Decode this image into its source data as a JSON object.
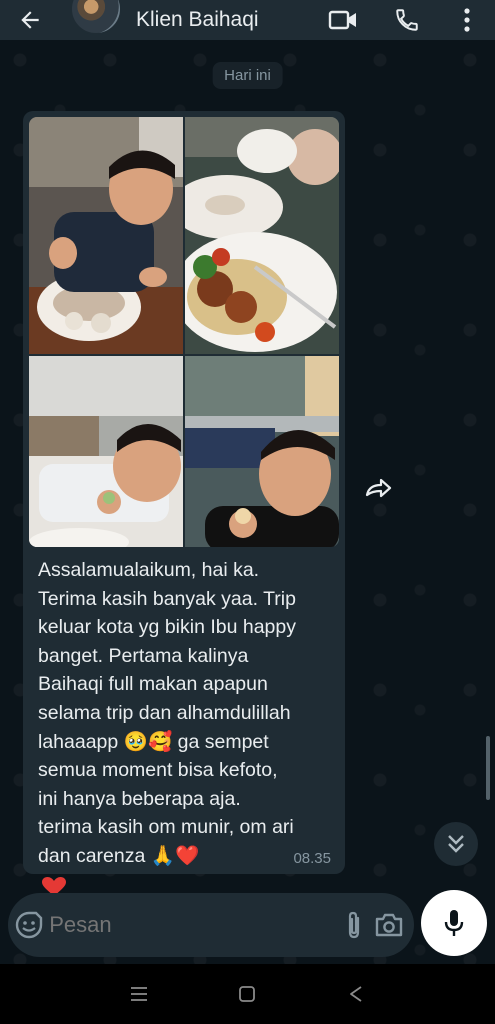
{
  "header": {
    "contact_name": "Klien Baihaqi"
  },
  "chat": {
    "date_chip": "Hari ini",
    "message": {
      "text": "Assalamualaikum, hai ka.\nTerima kasih banyak yaa. Trip\nkeluar kota yg bikin Ibu happy\nbanget. Pertama kalinya\nBaihaqi full makan apapun\nselama trip dan alhamdulillah\nlahaaapp 🥹🥰 ga sempet\nsemua moment bisa kefoto,\nini hanya beberapa aja.\nterima kasih om munir, om ari\ndan carenza 🙏❤️",
      "time": "08.35",
      "photo_count": 4,
      "reaction": "❤️"
    }
  },
  "input": {
    "placeholder": "Pesan"
  },
  "colors": {
    "header_bg": "#1f2c34",
    "chat_bg": "#0b141a",
    "bubble_bg": "#1f2c34",
    "text": "#e9edef",
    "muted": "#8696a0"
  },
  "icons": {
    "back": "arrow-left-icon",
    "video_call": "video-camera-icon",
    "voice_call": "phone-icon",
    "menu": "more-vert-icon",
    "forward": "forward-icon",
    "scroll_down": "chevron-double-down-icon",
    "emoji": "emoji-icon",
    "attach": "paperclip-icon",
    "camera": "camera-icon",
    "mic": "microphone-icon"
  }
}
